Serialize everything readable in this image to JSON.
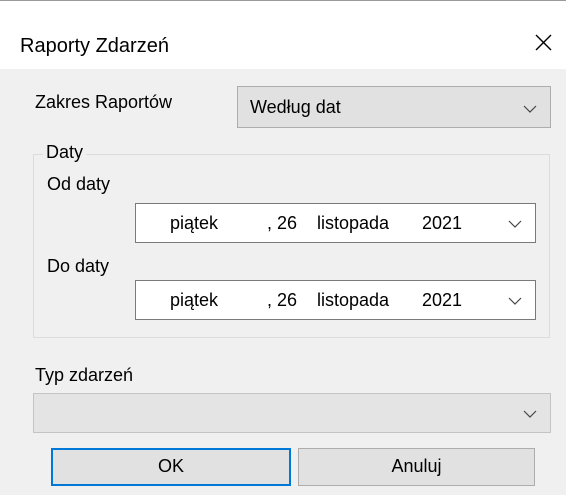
{
  "window": {
    "title": "Raporty Zdarzeń"
  },
  "report_range": {
    "label": "Zakres Raportów",
    "value": "Według dat"
  },
  "dates_group": {
    "legend": "Daty",
    "from": {
      "label": "Od daty",
      "weekday": "piątek",
      "day": ", 26",
      "month": "listopada",
      "year": "2021"
    },
    "to": {
      "label": "Do daty",
      "weekday": "piątek",
      "day": ", 26",
      "month": "listopada",
      "year": "2021"
    }
  },
  "event_type": {
    "label": "Typ zdarzeń",
    "value": ""
  },
  "buttons": {
    "ok": "OK",
    "cancel": "Anuluj"
  },
  "icons": {
    "close": "close-icon",
    "dropdown": "chevron-down-icon"
  }
}
